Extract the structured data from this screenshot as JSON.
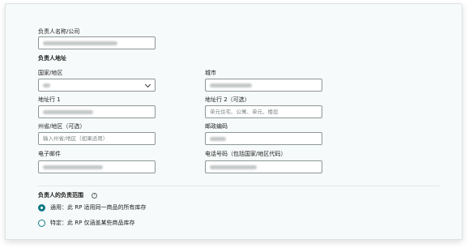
{
  "form": {
    "name_label": "负责人名称/公司",
    "address_heading": "负责人地址",
    "country_label": "国家/地区",
    "city_label": "城市",
    "address1_label": "地址行 1",
    "address2_label": "地址行 2（可选）",
    "address2_placeholder": "单元住宅、公寓、单元、楼层",
    "state_label": "州省/地区（可选）",
    "state_placeholder": "输入州省/地区（如果适用）",
    "postal_label": "邮政编码",
    "email_label": "电子邮件",
    "phone_label": "电话号码（包括国家/地区代码）"
  },
  "scope": {
    "heading": "负责人的负责范围",
    "options": [
      {
        "label": "通用：此 RP 适用同一商品的所有库存",
        "selected": true
      },
      {
        "label": "特定：此 RP 仅涵盖某些商品库存",
        "selected": false
      }
    ]
  },
  "colors": {
    "accent": "#0d7a86",
    "card_bg": "#f7fafa",
    "border": "#8d9696"
  },
  "icons": {
    "help": "help-circle-icon",
    "dropdown": "chevron-down-icon"
  }
}
